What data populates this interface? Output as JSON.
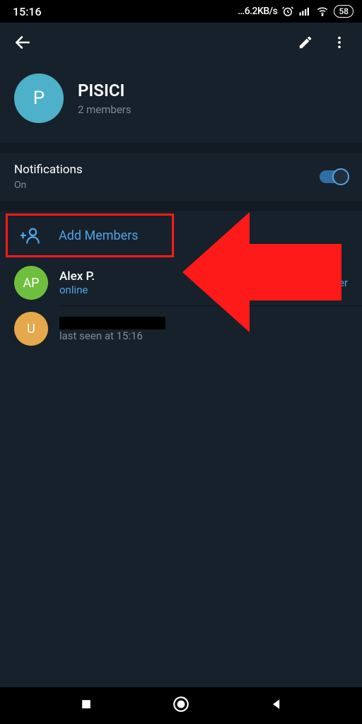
{
  "status": {
    "time": "15:16",
    "net": "…6.2KB/s",
    "battery": "58"
  },
  "profile": {
    "avatar_letter": "P",
    "avatar_color": "#4db1c9",
    "title": "PISICI",
    "subtitle": "2 members"
  },
  "notifications": {
    "label": "Notifications",
    "value": "On",
    "enabled": true
  },
  "add_members_label": "Add Members",
  "members": [
    {
      "avatar_text": "AP",
      "avatar_color": "#6fbf3f",
      "name": "Alex P.",
      "status": "online",
      "status_style": "accent",
      "role": "Owner",
      "name_redacted": false
    },
    {
      "avatar_text": "U",
      "avatar_color": "#e6a84d",
      "name": "",
      "status": "last seen at 15:16",
      "status_style": "gray",
      "role": "",
      "name_redacted": true
    }
  ]
}
